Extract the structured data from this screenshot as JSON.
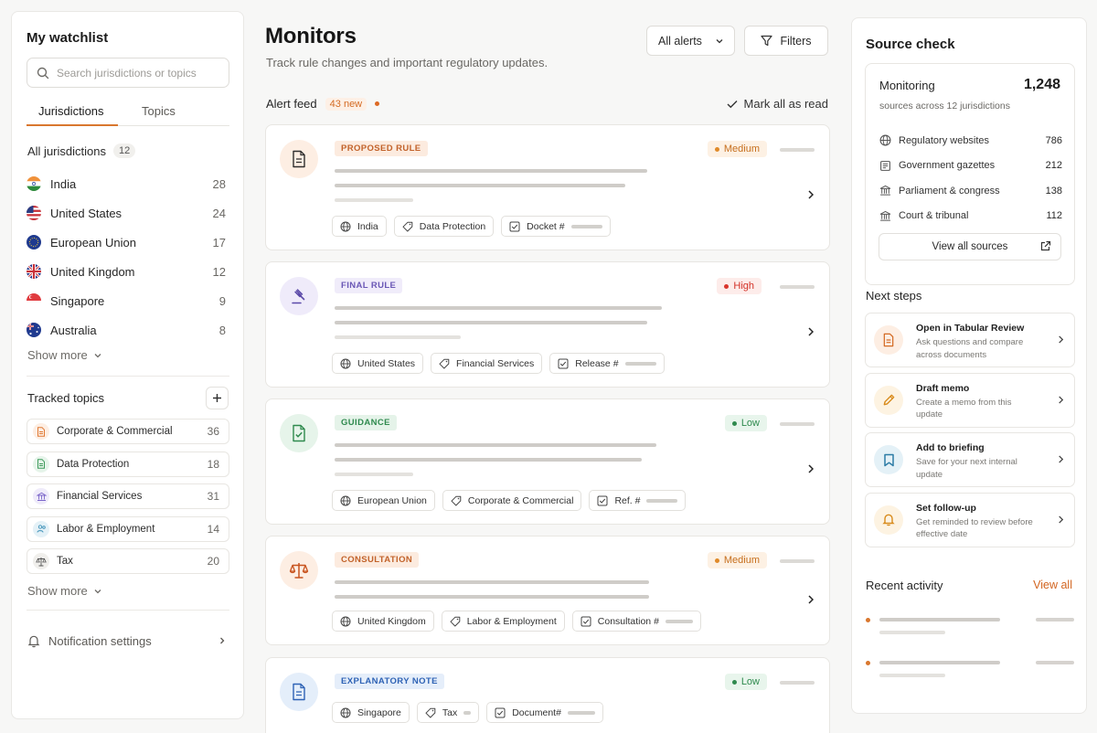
{
  "watchlist": {
    "title": "My watchlist",
    "search_placeholder": "Search jurisdictions or topics",
    "tabs": [
      {
        "label": "Jurisdictions",
        "active": true
      },
      {
        "label": "Topics",
        "active": false
      }
    ],
    "all_label": "All jurisdictions",
    "all_count": "12",
    "jurisdictions": [
      {
        "name": "India",
        "count": "28",
        "flag": "india"
      },
      {
        "name": "United States",
        "count": "24",
        "flag": "us"
      },
      {
        "name": "European Union",
        "count": "17",
        "flag": "eu"
      },
      {
        "name": "United Kingdom",
        "count": "12",
        "flag": "uk"
      },
      {
        "name": "Singapore",
        "count": "9",
        "flag": "singapore"
      },
      {
        "name": "Australia",
        "count": "8",
        "flag": "australia"
      }
    ],
    "show_more": "Show more",
    "topics_title": "Tracked topics",
    "topics": [
      {
        "name": "Corporate & Commercial",
        "count": "36",
        "icon": "document-icon",
        "color": "#e07a36"
      },
      {
        "name": "Data Protection",
        "count": "18",
        "icon": "document-icon",
        "color": "#3f9b5c"
      },
      {
        "name": "Financial Services",
        "count": "31",
        "icon": "bank-icon",
        "color": "#7b66c9"
      },
      {
        "name": "Labor & Employment",
        "count": "14",
        "icon": "people-icon",
        "color": "#3a8fb7"
      },
      {
        "name": "Tax",
        "count": "20",
        "icon": "scale-icon",
        "color": "#555555"
      }
    ],
    "notification_settings": "Notification settings"
  },
  "monitors": {
    "title": "Monitors",
    "subtitle": "Track rule changes and important regulatory updates.",
    "alerts_select": "All alerts",
    "filters_label": "Filters",
    "feed_label": "Alert feed",
    "new_count": "43 new",
    "mark_read": "Mark all as read",
    "cards": [
      {
        "type": "PROPOSED RULE",
        "severity": "Medium",
        "jurisdiction": "India",
        "topic": "Data Protection",
        "ref": "Docket #"
      },
      {
        "type": "FINAL RULE",
        "severity": "High",
        "jurisdiction": "United States",
        "topic": "Financial Services",
        "ref": "Release #"
      },
      {
        "type": "GUIDANCE",
        "severity": "Low",
        "jurisdiction": "European Union",
        "topic": "Corporate & Commercial",
        "ref": "Ref. #"
      },
      {
        "type": "CONSULTATION",
        "severity": "Medium",
        "jurisdiction": "United Kingdom",
        "topic": "Labor & Employment",
        "ref": "Consultation #"
      },
      {
        "type": "EXPLANATORY NOTE",
        "severity": "Low",
        "jurisdiction": "Singapore",
        "topic": "Tax",
        "ref": "Document#"
      }
    ]
  },
  "source_check": {
    "title": "Source check",
    "monitoring_label": "Monitoring",
    "monitoring_count": "1,248",
    "monitoring_desc": "sources across 12 jurisdictions",
    "sources": [
      {
        "name": "Regulatory websites",
        "count": "786",
        "icon": "globe-icon"
      },
      {
        "name": "Government gazettes",
        "count": "212",
        "icon": "newspaper-icon"
      },
      {
        "name": "Parliament & congress",
        "count": "138",
        "icon": "building-icon"
      },
      {
        "name": "Court & tribunal",
        "count": "112",
        "icon": "building-icon"
      }
    ],
    "view_all_sources": "View all sources",
    "next_steps_title": "Next steps",
    "next_steps": [
      {
        "title": "Open in Tabular Review",
        "desc": "Ask questions and compare across documents",
        "icon": "document-icon"
      },
      {
        "title": "Draft memo",
        "desc": "Create a memo from this update",
        "icon": "pencil-icon"
      },
      {
        "title": "Add to briefing",
        "desc": "Save for your next internal update",
        "icon": "bookmark-icon"
      },
      {
        "title": "Set follow-up",
        "desc": "Get reminded to review before effective date",
        "icon": "bell-icon"
      }
    ],
    "recent_title": "Recent activity",
    "recent_link": "View all"
  },
  "colors": {
    "accent": "#d9772e",
    "high": "#d9342b",
    "low": "#2f8a4e",
    "medium": "#d97a1f"
  }
}
